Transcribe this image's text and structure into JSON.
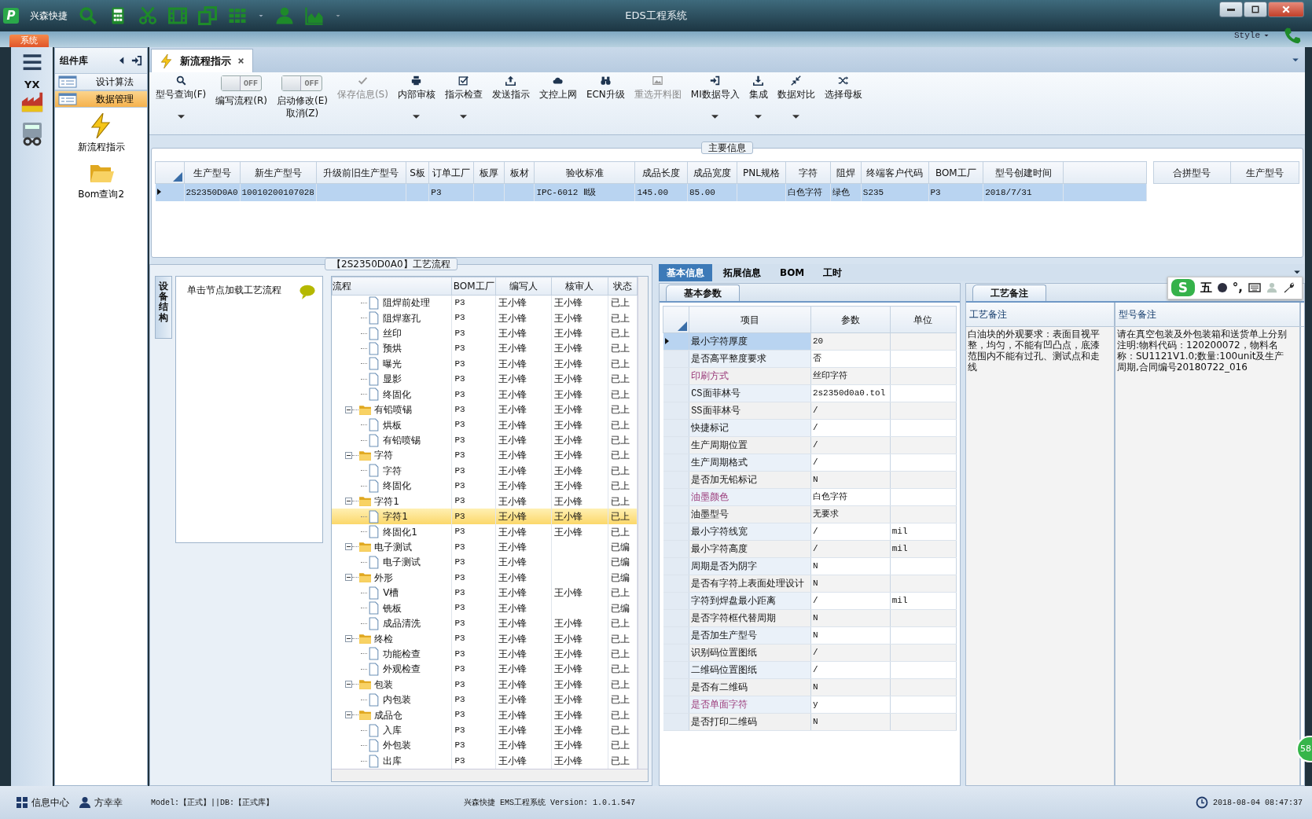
{
  "window": {
    "logo_letter": "P",
    "app_name": "兴森快捷",
    "title": "EDS工程系统"
  },
  "ribbon": {
    "system_tab": "系统",
    "style_label": "Style"
  },
  "nav_strip": {
    "factory_label": "YX"
  },
  "nav_panel": {
    "title": "组件库",
    "items": [
      {
        "label": "设计算法",
        "selected": false
      },
      {
        "label": "数据管理",
        "selected": true
      }
    ],
    "tools": [
      {
        "label": "新流程指示"
      },
      {
        "label": "Bom查询2"
      }
    ]
  },
  "document_tab": {
    "label": "新流程指示",
    "selected": true
  },
  "toolbar": [
    {
      "kind": "button",
      "label": "型号查询(F)",
      "dropdown": true,
      "disabled": false
    },
    {
      "kind": "toggle",
      "label": "编写流程(R)",
      "switch_text": "OFF",
      "on": false
    },
    {
      "kind": "toggle",
      "label": "启动修改(E)\n取消(Z)",
      "switch_text": "OFF",
      "on": false
    },
    {
      "kind": "button",
      "label": "保存信息(S)",
      "dropdown": false,
      "disabled": true
    },
    {
      "kind": "button",
      "label": "内部审核",
      "dropdown": true,
      "disabled": false
    },
    {
      "kind": "button",
      "label": "指示检查",
      "dropdown": true,
      "disabled": false
    },
    {
      "kind": "button",
      "label": "发送指示",
      "dropdown": false,
      "disabled": false
    },
    {
      "kind": "button",
      "label": "文控上网",
      "dropdown": false,
      "disabled": false
    },
    {
      "kind": "button",
      "label": "ECN升级",
      "dropdown": false,
      "disabled": false
    },
    {
      "kind": "button",
      "label": "重选开料图",
      "dropdown": false,
      "disabled": true
    },
    {
      "kind": "button",
      "label": "MI数据导入",
      "dropdown": true,
      "disabled": false
    },
    {
      "kind": "button",
      "label": "集成",
      "dropdown": true,
      "disabled": false
    },
    {
      "kind": "button",
      "label": "数据对比",
      "dropdown": true,
      "disabled": false
    },
    {
      "kind": "button",
      "label": "选择母板",
      "dropdown": false,
      "disabled": false
    }
  ],
  "main_info": {
    "title": "主要信息",
    "columns": [
      "生产型号",
      "新生产型号",
      "升级前旧生产型号",
      "S板",
      "订单工厂",
      "板厚",
      "板材",
      "验收标准",
      "成品长度",
      "成品宽度",
      "PNL规格",
      "字符",
      "阻焊",
      "终端客户代码",
      "BOM工厂",
      "型号创建时间"
    ],
    "rows": [
      {
        "selected": true,
        "cells": [
          "2S2350D0A0",
          "10010200107028",
          null,
          null,
          "P3",
          null,
          null,
          "IPC-6012 Ⅱ级",
          "145.00",
          "85.00",
          null,
          "白色字符",
          "绿色",
          "S235",
          "P3",
          "2018/7/31"
        ]
      }
    ],
    "side_columns": [
      "合拼型号",
      "生产型号"
    ]
  },
  "process": {
    "title": "【2S2350D0A0】工艺流程",
    "side_tab": "设备结构",
    "hint": "单击节点加载工艺流程",
    "columns": [
      "流程",
      "BOM工厂",
      "编写人",
      "核审人",
      "状态"
    ],
    "tree": [
      {
        "children": [
          {
            "label": "阻焊前处理",
            "bom": "P3",
            "writer": "王小锋",
            "reviewer": "王小锋",
            "status": "已上",
            "selected": false
          },
          {
            "label": "阻焊塞孔",
            "bom": "P3",
            "writer": "王小锋",
            "reviewer": "王小锋",
            "status": "已上",
            "selected": false
          },
          {
            "label": "丝印",
            "bom": "P3",
            "writer": "王小锋",
            "reviewer": "王小锋",
            "status": "已上",
            "selected": false
          },
          {
            "label": "预烘",
            "bom": "P3",
            "writer": "王小锋",
            "reviewer": "王小锋",
            "status": "已上",
            "selected": false
          },
          {
            "label": "曝光",
            "bom": "P3",
            "writer": "王小锋",
            "reviewer": "王小锋",
            "status": "已上",
            "selected": false
          },
          {
            "label": "显影",
            "bom": "P3",
            "writer": "王小锋",
            "reviewer": "王小锋",
            "status": "已上",
            "selected": false
          },
          {
            "label": "终固化",
            "bom": "P3",
            "writer": "王小锋",
            "reviewer": "王小锋",
            "status": "已上",
            "selected": false
          }
        ]
      },
      {
        "label": "有铅喷锡",
        "bom": "P3",
        "writer": "王小锋",
        "reviewer": "王小锋",
        "status": "已上",
        "selected": false,
        "expanded": true,
        "children": [
          {
            "label": "烘板",
            "bom": "P3",
            "writer": "王小锋",
            "reviewer": "王小锋",
            "status": "已上",
            "selected": false
          },
          {
            "label": "有铅喷锡",
            "bom": "P3",
            "writer": "王小锋",
            "reviewer": "王小锋",
            "status": "已上",
            "selected": false
          }
        ]
      },
      {
        "label": "字符",
        "bom": "P3",
        "writer": "王小锋",
        "reviewer": "王小锋",
        "status": "已上",
        "selected": false,
        "expanded": true,
        "children": [
          {
            "label": "字符",
            "bom": "P3",
            "writer": "王小锋",
            "reviewer": "王小锋",
            "status": "已上",
            "selected": false
          },
          {
            "label": "终固化",
            "bom": "P3",
            "writer": "王小锋",
            "reviewer": "王小锋",
            "status": "已上",
            "selected": false
          }
        ]
      },
      {
        "label": "字符1",
        "bom": "P3",
        "writer": "王小锋",
        "reviewer": "王小锋",
        "status": "已上",
        "selected": false,
        "expanded": true,
        "children": [
          {
            "label": "字符1",
            "bom": "P3",
            "writer": "王小锋",
            "reviewer": "王小锋",
            "status": "已上",
            "selected": true
          },
          {
            "label": "终固化1",
            "bom": "P3",
            "writer": "王小锋",
            "reviewer": "王小锋",
            "status": "已上",
            "selected": false
          }
        ]
      },
      {
        "label": "电子测试",
        "bom": "P3",
        "writer": "王小锋",
        "status": "已编",
        "selected": false,
        "expanded": true,
        "children": [
          {
            "label": "电子测试",
            "bom": "P3",
            "writer": "王小锋",
            "status": "已编",
            "selected": false
          }
        ]
      },
      {
        "label": "外形",
        "bom": "P3",
        "writer": "王小锋",
        "status": "已编",
        "selected": false,
        "expanded": true,
        "children": [
          {
            "label": "V槽",
            "bom": "P3",
            "writer": "王小锋",
            "reviewer": "王小锋",
            "status": "已上",
            "selected": false
          },
          {
            "label": "铣板",
            "bom": "P3",
            "writer": "王小锋",
            "status": "已编",
            "selected": false
          },
          {
            "label": "成品清洗",
            "bom": "P3",
            "writer": "王小锋",
            "reviewer": "王小锋",
            "status": "已上",
            "selected": false
          }
        ]
      },
      {
        "label": "终检",
        "bom": "P3",
        "writer": "王小锋",
        "reviewer": "王小锋",
        "status": "已上",
        "selected": false,
        "expanded": true,
        "children": [
          {
            "label": "功能检查",
            "bom": "P3",
            "writer": "王小锋",
            "reviewer": "王小锋",
            "status": "已上",
            "selected": false
          },
          {
            "label": "外观检查",
            "bom": "P3",
            "writer": "王小锋",
            "reviewer": "王小锋",
            "status": "已上",
            "selected": false
          }
        ]
      },
      {
        "label": "包装",
        "bom": "P3",
        "writer": "王小锋",
        "reviewer": "王小锋",
        "status": "已上",
        "selected": false,
        "expanded": true,
        "children": [
          {
            "label": "内包装",
            "bom": "P3",
            "writer": "王小锋",
            "reviewer": "王小锋",
            "status": "已上",
            "selected": false
          }
        ]
      },
      {
        "label": "成品仓",
        "bom": "P3",
        "writer": "王小锋",
        "reviewer": "王小锋",
        "status": "已上",
        "selected": false,
        "expanded": true,
        "children": [
          {
            "label": "入库",
            "bom": "P3",
            "writer": "王小锋",
            "reviewer": "王小锋",
            "status": "已上",
            "selected": false
          },
          {
            "label": "外包装",
            "bom": "P3",
            "writer": "王小锋",
            "reviewer": "王小锋",
            "status": "已上",
            "selected": false
          },
          {
            "label": "出库",
            "bom": "P3",
            "writer": "王小锋",
            "reviewer": "王小锋",
            "status": "已上",
            "selected": false
          }
        ]
      }
    ]
  },
  "detail_tabs": [
    {
      "label": "基本信息",
      "selected": true
    },
    {
      "label": "拓展信息",
      "selected": false
    },
    {
      "label": "BOM",
      "selected": false
    },
    {
      "label": "工时",
      "selected": false
    }
  ],
  "params": {
    "tab": "基本参数",
    "columns": [
      "项目",
      "参数",
      "单位"
    ],
    "rows": [
      {
        "item": "最小字符厚度",
        "value": "20",
        "selected": true,
        "marked": false
      },
      {
        "item": "是否高平整度要求",
        "value": "否",
        "selected": false,
        "marked": false
      },
      {
        "item": "印刷方式",
        "value": "丝印字符",
        "selected": false,
        "marked": true
      },
      {
        "item": "CS面菲林号",
        "value": "2s2350d0a0.tol",
        "selected": false,
        "marked": false
      },
      {
        "item": "SS面菲林号",
        "value": "/",
        "selected": false,
        "marked": false
      },
      {
        "item": "快捷标记",
        "value": "/",
        "selected": false,
        "marked": false
      },
      {
        "item": "生产周期位置",
        "value": "/",
        "selected": false,
        "marked": false
      },
      {
        "item": "生产周期格式",
        "value": "/",
        "selected": false,
        "marked": false
      },
      {
        "item": "是否加无铅标记",
        "value": "N",
        "selected": false,
        "marked": false
      },
      {
        "item": "油墨颜色",
        "value": "白色字符",
        "selected": false,
        "marked": true
      },
      {
        "item": "油墨型号",
        "value": "无要求",
        "selected": false,
        "marked": false
      },
      {
        "item": "最小字符线宽",
        "value": "/",
        "unit": "mil",
        "selected": false,
        "marked": false
      },
      {
        "item": "最小字符高度",
        "value": "/",
        "unit": "mil",
        "selected": false,
        "marked": false
      },
      {
        "item": "周期是否为阴字",
        "value": "N",
        "selected": false,
        "marked": false
      },
      {
        "item": "是否有字符上表面处理设计",
        "value": "N",
        "selected": false,
        "marked": false
      },
      {
        "item": "字符到焊盘最小距离",
        "value": "/",
        "unit": "mil",
        "selected": false,
        "marked": false
      },
      {
        "item": "是否字符框代替周期",
        "value": "N",
        "selected": false,
        "marked": false
      },
      {
        "item": "是否加生产型号",
        "value": "N",
        "selected": false,
        "marked": false
      },
      {
        "item": "识别码位置图纸",
        "value": "/",
        "selected": false,
        "marked": false
      },
      {
        "item": "二维码位置图纸",
        "value": "/",
        "selected": false,
        "marked": false
      },
      {
        "item": "是否有二维码",
        "value": "N",
        "selected": false,
        "marked": false
      },
      {
        "item": "是否单面字符",
        "value": "y",
        "selected": false,
        "marked": true
      },
      {
        "item": "是否打印二维码",
        "value": "N",
        "selected": false,
        "marked": false
      }
    ]
  },
  "remarks": {
    "tab": "工艺备注",
    "columns": [
      {
        "title": "工艺备注",
        "text": "白油块的外观要求：表面目视平整，均匀，不能有凹凸点，底漆范围内不能有过孔、测试点和走线"
      },
      {
        "title": "型号备注",
        "text": "请在真空包装及外包装箱和送货单上分别注明:物料代码：120200072，物料名称：SU1121V1.0;数量:100unit及生产周期,合同编号20180722_016"
      }
    ]
  },
  "ime_bar": {
    "logo": "S",
    "mode": "五",
    "punct": "°,"
  },
  "corner_badge": "58",
  "status_bar": {
    "info_center": "信息中心",
    "user": "方幸幸",
    "env": "Model:【正式】||DB:【正式库】",
    "app_version": "兴森快捷 EMS工程系统 Version: 1.0.1.547",
    "datetime": "2018-08-04 08:47:37"
  }
}
